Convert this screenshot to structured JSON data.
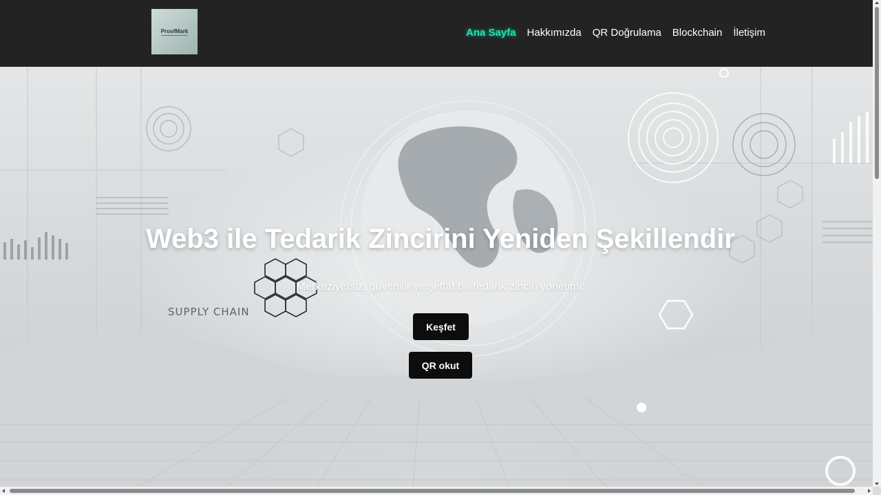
{
  "logo": {
    "text": "ProofMark"
  },
  "nav": {
    "items": [
      {
        "label": "Ana Sayfa",
        "active": true
      },
      {
        "label": "Hakkımızda",
        "active": false
      },
      {
        "label": "QR Doğrulama",
        "active": false
      },
      {
        "label": "Blockchain",
        "active": false
      },
      {
        "label": "İletişim",
        "active": false
      }
    ],
    "active_color": "#19e6b0"
  },
  "hero": {
    "title": "Web3 ile Tedarik Zincirini Yeniden Şekillendir",
    "subtitle": "Merkeziyetsiz, güvenilir ve şeffaf bir tedarik zinciri yönetimi.",
    "background_label": "SUPPLY CHAIN",
    "buttons": {
      "explore": "Keşfet",
      "qr": "QR okut"
    }
  },
  "colors": {
    "navbar": "#232323",
    "button": "#0d0d0d"
  }
}
